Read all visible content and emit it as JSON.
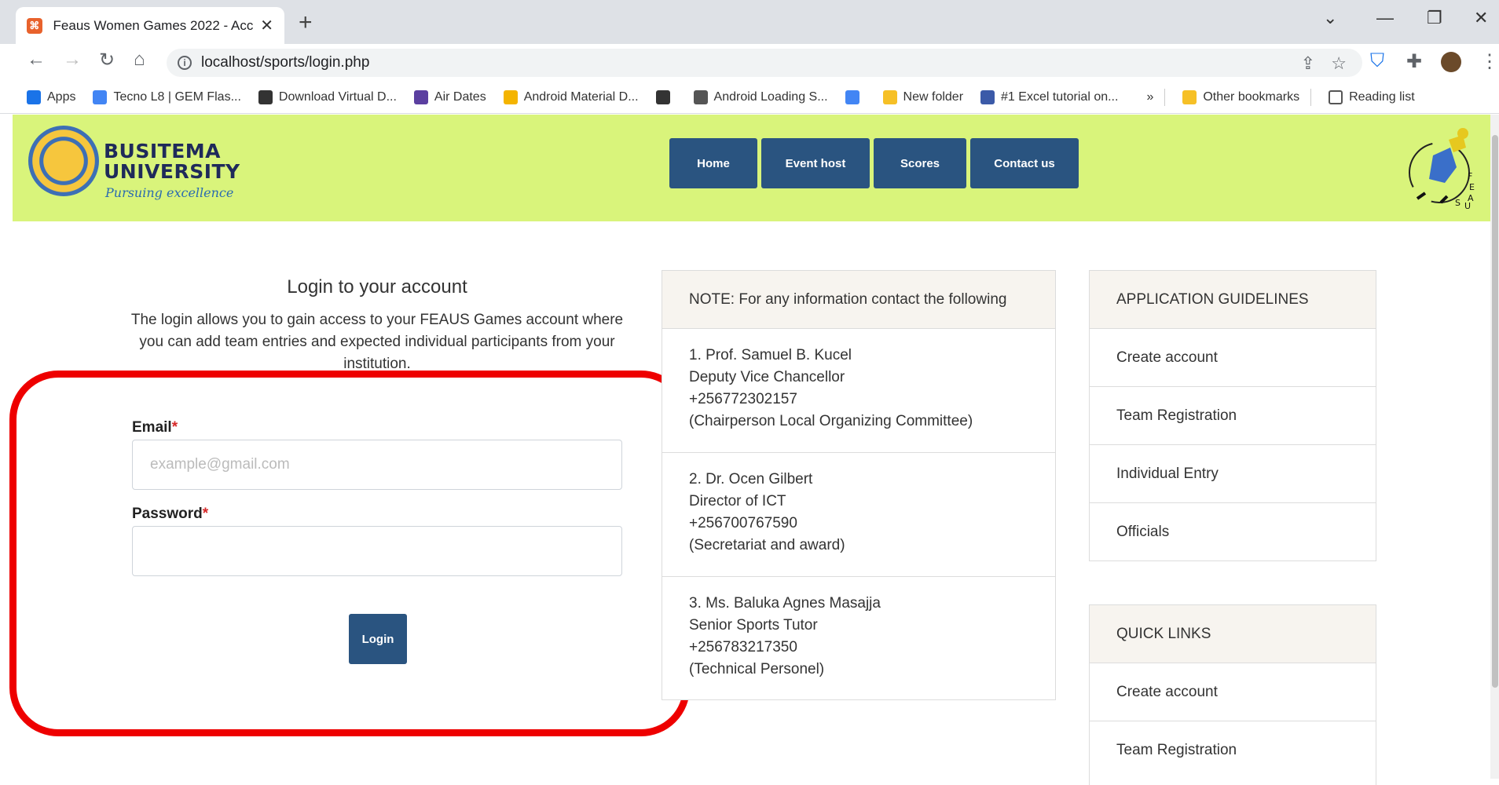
{
  "browser": {
    "tab_title": "Feaus Women Games 2022 - Acc",
    "url": "localhost/sports/login.php",
    "bookmarks": [
      {
        "label": "Apps",
        "icon": "apps-grid-icon",
        "color": "#1a73e8"
      },
      {
        "label": "Tecno L8 | GEM Flas...",
        "icon": "gem-icon",
        "color": "#4285f4"
      },
      {
        "label": "Download Virtual D...",
        "icon": "globe-icon",
        "color": "#333333"
      },
      {
        "label": "Air Dates",
        "icon": "tv-icon",
        "color": "#5b3fa0"
      },
      {
        "label": "Android Material D...",
        "icon": "material-icon",
        "color": "#f4b400"
      },
      {
        "label": "",
        "icon": "globe-icon",
        "color": "#333333"
      },
      {
        "label": "Android Loading S...",
        "icon": "diamond-icon",
        "color": "#555555"
      },
      {
        "label": "",
        "icon": "google-icon",
        "color": "#4285f4"
      },
      {
        "label": "New folder",
        "icon": "folder-icon",
        "color": "#f6c026"
      },
      {
        "label": "#1 Excel tutorial on...",
        "icon": "excel-icon",
        "color": "#3b5aa8"
      }
    ],
    "more_bookmarks": "»",
    "other_bookmarks": "Other bookmarks",
    "reading_list": "Reading list"
  },
  "site": {
    "logo_name_line1": "BUSITEMA",
    "logo_name_line2": "UNIVERSITY",
    "logo_tagline": "Pursuing excellence",
    "nav": [
      "Home",
      "Event host",
      "Scores",
      "Contact us"
    ],
    "accent_color": "#2a5480",
    "header_color": "#d9f47b"
  },
  "login": {
    "title": "Login to your account",
    "description": "The login allows you to gain access to your FEAUS Games account where you can add team entries and expected individual participants from your institution.",
    "email_label": "Email",
    "email_placeholder": "example@gmail.com",
    "password_label": "Password",
    "required_mark": "*",
    "button_label": "Login"
  },
  "note_panel": {
    "heading": "NOTE: For any information contact the following",
    "contacts": [
      {
        "line1": "1. Prof. Samuel B. Kucel",
        "line2": "Deputy Vice Chancellor",
        "line3": "+256772302157",
        "line4": "(Chairperson Local Organizing Committee)"
      },
      {
        "line1": "2. Dr. Ocen Gilbert",
        "line2": "Director of ICT",
        "line3": "+256700767590",
        "line4": "(Secretariat and award)"
      },
      {
        "line1": "3. Ms. Baluka Agnes Masajja",
        "line2": "Senior Sports Tutor",
        "line3": "+256783217350",
        "line4": "(Technical Personel)"
      }
    ]
  },
  "guidelines_panel": {
    "heading": "APPLICATION GUIDELINES",
    "items": [
      "Create account",
      "Team Registration",
      "Individual Entry",
      "Officials"
    ]
  },
  "quick_links_panel": {
    "heading": "QUICK LINKS",
    "items": [
      "Create account",
      "Team Registration"
    ]
  }
}
